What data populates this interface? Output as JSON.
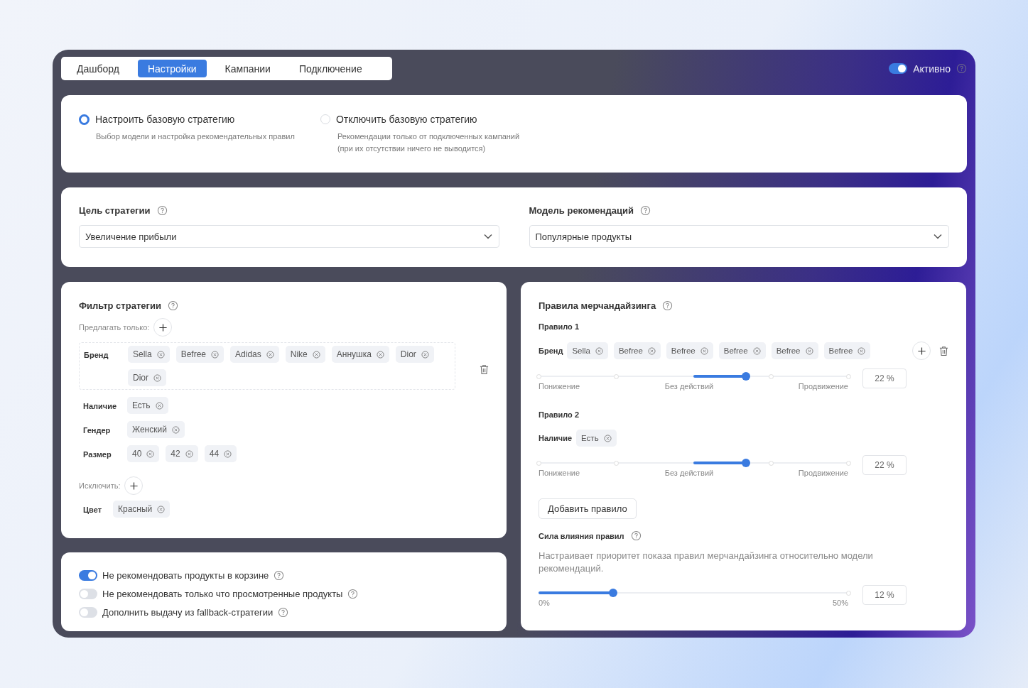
{
  "tabs": [
    {
      "label": "Дашборд",
      "selected": false
    },
    {
      "label": "Настройки",
      "selected": true
    },
    {
      "label": "Кампании",
      "selected": false
    },
    {
      "label": "Подключение",
      "selected": false
    }
  ],
  "status": {
    "label": "Активно",
    "on": true
  },
  "strategy_options": [
    {
      "title": "Настроить базовую стратегию",
      "description": "Выбор модели и настройка рекомендательных правил",
      "selected": true
    },
    {
      "title": "Отключить базовую стратегию",
      "description": "Рекомендации только от подключенных кампаний\n(при их отсутствии ничего не выводится)",
      "selected": false
    }
  ],
  "selects": [
    {
      "label": "Цель стратегии",
      "value": "Увеличение прибыли"
    },
    {
      "label": "Модель рекомендаций",
      "value": "Популярные продукты"
    }
  ],
  "filter": {
    "title": "Фильтр стратегии",
    "include_label": "Предлагать только:",
    "include_groups": [
      {
        "label": "Бренд",
        "kind": "boxed",
        "tags": [
          "Sella",
          "Befree",
          "Adidas",
          "Nike",
          "Аннушка",
          "Dior",
          "Dior"
        ]
      },
      {
        "label": "Наличие",
        "kind": "plain",
        "tags": [
          "Есть"
        ]
      },
      {
        "label": "Гендер",
        "kind": "plain",
        "tags": [
          "Женский"
        ]
      },
      {
        "label": "Размер",
        "kind": "plain",
        "tags": [
          "40",
          "42",
          "44"
        ]
      }
    ],
    "exclude_label": "Исключить:",
    "exclude_groups": [
      {
        "label": "Цвет",
        "kind": "compact",
        "tags": [
          "Красный"
        ]
      }
    ]
  },
  "options": [
    {
      "label": "Не рекомендовать продукты в корзине",
      "on": true
    },
    {
      "label": "Не рекомендовать только что просмотренные продукты",
      "on": false
    },
    {
      "label": "Дополнить выдачу из fallback-стратегии",
      "on": false
    }
  ],
  "merch": {
    "title": "Правила мерчандайзинга",
    "rules": [
      {
        "title": "Правило 1",
        "field": "Бренд",
        "actions": true,
        "tags": [
          "Sella",
          "Befree",
          "Befree",
          "Befree",
          "Befree",
          "Befree"
        ],
        "level": 0.67,
        "low": "Понижение",
        "mid": "Без действий",
        "high": "Продвижение",
        "reading": "22 %"
      },
      {
        "title": "Правило 2",
        "field": "Наличие",
        "actions": false,
        "tags": [
          "Есть"
        ],
        "level": 0.67,
        "low": "Понижение",
        "mid": "Без действий",
        "high": "Продвижение",
        "reading": "22 %"
      }
    ],
    "add_button": "Добавить правило",
    "strength": {
      "title": "Сила влияния правил",
      "description": "Настраивает приоритет показа правил мерчандайзинга относительно модели рекомендаций.",
      "level": 0.24,
      "min": "0%",
      "max": "50%",
      "reading": "12 %"
    }
  }
}
